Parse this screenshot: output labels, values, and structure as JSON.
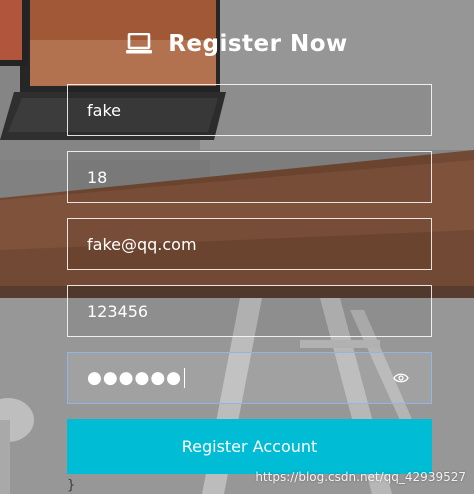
{
  "title": {
    "text": "Register Now",
    "icon": "laptop-icon"
  },
  "form": {
    "name_value": "fake",
    "age_value": "18",
    "email_value": "fake@qq.com",
    "password_value": "123456",
    "confirm_password_masked": "●●●●●●",
    "confirm_password_icon": "eye-icon"
  },
  "submit": {
    "label": "Register Account"
  },
  "watermark": {
    "text": "https://blog.csdn.net/qq_42939527"
  },
  "colors": {
    "accent": "#00bcd4",
    "field_border": "#ffffff",
    "active_border": "#8fb7e6"
  }
}
